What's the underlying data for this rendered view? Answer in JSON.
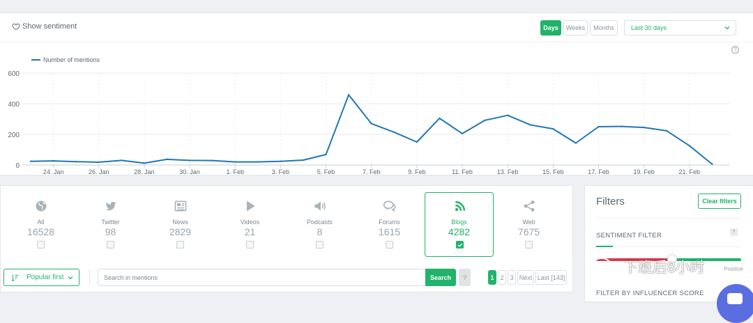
{
  "header": {
    "show_sentiment": "Show sentiment",
    "periods": [
      "Days",
      "Weeks",
      "Months"
    ],
    "active_period": "Days",
    "range": "Last 30 days",
    "help": "?"
  },
  "chart_data": {
    "type": "line",
    "series": [
      {
        "name": "Number of mentions",
        "color": "#1f77b4",
        "values": [
          24,
          27,
          22,
          18,
          30,
          12,
          37,
          30,
          29,
          20,
          20,
          24,
          32,
          68,
          458,
          270,
          214,
          150,
          305,
          205,
          292,
          324,
          262,
          236,
          143,
          250,
          252,
          245,
          223,
          126,
          5
        ]
      }
    ],
    "x": [
      "23. Jan",
      "24. Jan",
      "25. Jan",
      "26. Jan",
      "27. Jan",
      "28. Jan",
      "29. Jan",
      "30. Jan",
      "31. Jan",
      "1. Feb",
      "2. Feb",
      "3. Feb",
      "4. Feb",
      "5. Feb",
      "6. Feb",
      "7. Feb",
      "8. Feb",
      "9. Feb",
      "10. Feb",
      "11. Feb",
      "12. Feb",
      "13. Feb",
      "14. Feb",
      "15. Feb",
      "16. Feb",
      "17. Feb",
      "18. Feb",
      "19. Feb",
      "20. Feb",
      "21. Feb",
      "22. Feb"
    ],
    "x_tick_labels": [
      "24. Jan",
      "26. Jan",
      "28. Jan",
      "30. Jan",
      "1. Feb",
      "3. Feb",
      "5. Feb",
      "7. Feb",
      "9. Feb",
      "11. Feb",
      "13. Feb",
      "15. Feb",
      "17. Feb",
      "19. Feb",
      "21. Feb"
    ],
    "y_ticks": [
      "0",
      "200",
      "400",
      "600"
    ],
    "ylim": [
      0,
      600
    ],
    "grid": true,
    "legend": "top-left"
  },
  "sources": [
    {
      "name": "All",
      "count": "16528",
      "icon": "globe-icon",
      "active": false
    },
    {
      "name": "Twitter",
      "count": "98",
      "icon": "twitter-icon",
      "active": false
    },
    {
      "name": "News",
      "count": "2829",
      "icon": "newspaper-icon",
      "active": false
    },
    {
      "name": "Videos",
      "count": "21",
      "icon": "play-icon",
      "active": false
    },
    {
      "name": "Podcasts",
      "count": "8",
      "icon": "speaker-icon",
      "active": false
    },
    {
      "name": "Forums",
      "count": "1615",
      "icon": "chat-icon",
      "active": false
    },
    {
      "name": "Blogs",
      "count": "4282",
      "icon": "rss-icon",
      "active": true
    },
    {
      "name": "Web",
      "count": "7675",
      "icon": "share-icon",
      "active": false
    }
  ],
  "toolbar": {
    "sort_label": "Popular first",
    "search_placeholder": "Search in mentions",
    "search_button": "Search",
    "help": "?",
    "pages": [
      "1",
      "2",
      "3",
      "Next",
      "Last [143]"
    ]
  },
  "filters": {
    "title": "Filters",
    "clear_label": "Clear filters",
    "sentiment_label": "SENTIMENT FILTER",
    "help": "?",
    "positive_label": "Positive",
    "influencer_label": "FILTER BY INFLUENCER SCORE"
  },
  "watermark": {
    "text": "下班后8小时"
  },
  "colors": {
    "accent": "#21b36a",
    "line": "#1f77b4",
    "negative": "#d9394e",
    "chat": "#5b6ee1"
  }
}
